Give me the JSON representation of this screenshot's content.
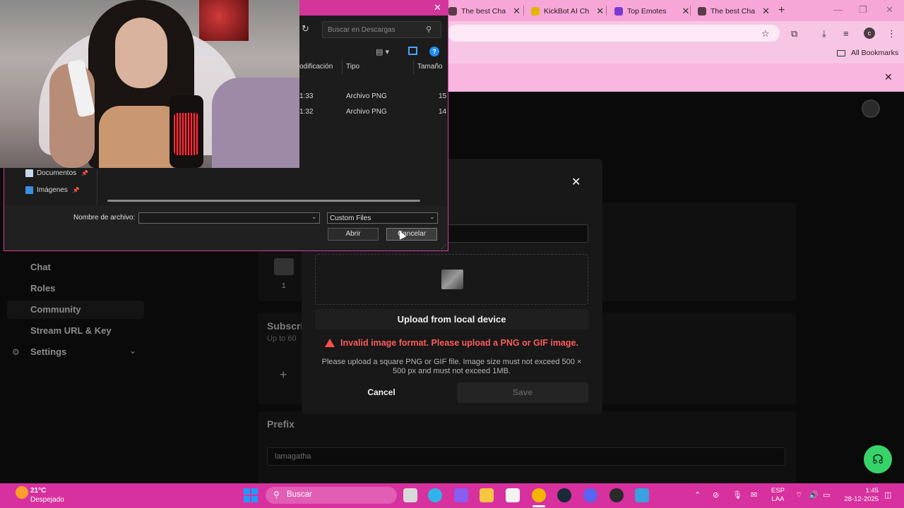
{
  "browser": {
    "tabs": [
      {
        "label": "The best Cha",
        "color": "#5a3a4a"
      },
      {
        "label": "KickBot AI Ch",
        "color": "#e3b400"
      },
      {
        "label": "Top Emotes",
        "color": "#7a3ad1"
      },
      {
        "label": "The best Cha",
        "color": "#5a3a4a"
      }
    ],
    "bookmarks_label": "All Bookmarks",
    "avatar_letter": "c"
  },
  "sidebar": {
    "items": [
      {
        "label": "Chat"
      },
      {
        "label": "Roles"
      },
      {
        "label": "Community"
      },
      {
        "label": "Stream URL & Key"
      },
      {
        "label": "Settings"
      }
    ]
  },
  "page": {
    "emote_count": "1",
    "subscriber_title": "Subscri",
    "subscriber_desc": "Up to 60",
    "plus": "+",
    "prefix_title": "Prefix",
    "prefix_value": "lamagatha"
  },
  "modal": {
    "upload_label": "Upload from local device",
    "error": "Invalid image format. Please upload a PNG or GIF image.",
    "help": "Please upload a square PNG or GIF file. Image size must not exceed 500 × 500 px and must not exceed 1MB.",
    "cancel_label": "Cancel",
    "save_label": "Save"
  },
  "file_dialog": {
    "search_placeholder": "Buscar en Descargas",
    "columns": [
      "odificación",
      "Tipo",
      "Tamaño"
    ],
    "rows": [
      {
        "modified": "1:33",
        "type": "Archivo PNG",
        "size": "15"
      },
      {
        "modified": "1:32",
        "type": "Archivo PNG",
        "size": "14"
      }
    ],
    "nav": [
      {
        "label": "Documentos",
        "color": "#c7d6ea"
      },
      {
        "label": "Imágenes",
        "color": "#3a8fe0"
      }
    ],
    "filename_label": "Nombre de archivo:",
    "filter_value": "Custom Files",
    "open_label": "Abrir",
    "cancel_label": "Cancelar"
  },
  "taskbar": {
    "temperature": "21°C",
    "weather": "Despejado",
    "search_label": "Buscar",
    "lang_line1": "ESP",
    "lang_line2": "LAA",
    "time": "1:45",
    "date": "28-12-2025",
    "apps": [
      {
        "name": "task-view",
        "color": "#d9d9d9"
      },
      {
        "name": "edge",
        "color": "#2fb3e8"
      },
      {
        "name": "copilot",
        "color": "#8a5cf0"
      },
      {
        "name": "file-explorer",
        "color": "#f7c640"
      },
      {
        "name": "store",
        "color": "#f2f2f2"
      },
      {
        "name": "chrome",
        "color": "#f4b400"
      },
      {
        "name": "steam",
        "color": "#1b2838"
      },
      {
        "name": "discord",
        "color": "#5865f2"
      },
      {
        "name": "obs",
        "color": "#2a2a2a"
      },
      {
        "name": "app",
        "color": "#3aa0e0"
      }
    ]
  }
}
